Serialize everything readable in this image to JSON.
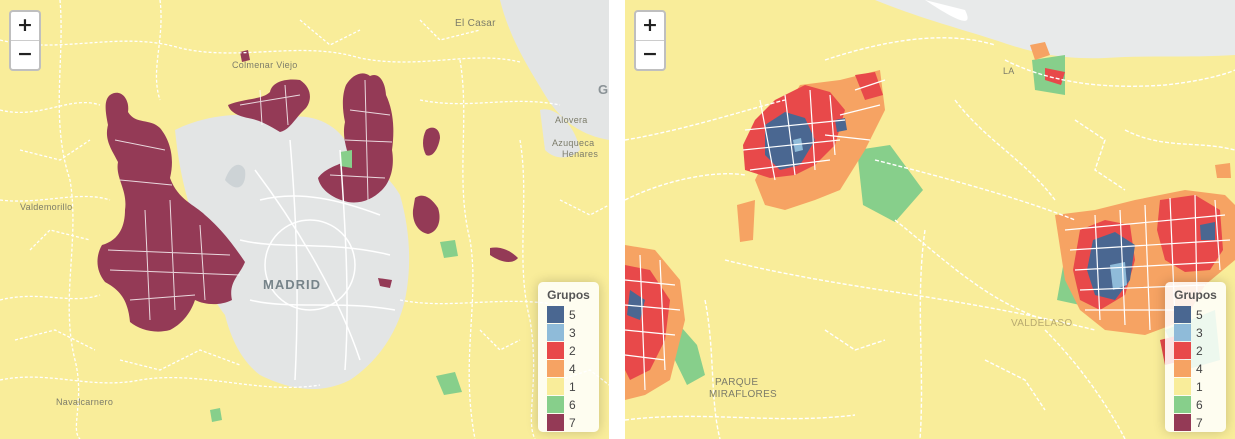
{
  "colors": {
    "g5": "#4a6791",
    "g3": "#8fbbd9",
    "g2": "#e8494a",
    "g4": "#f6a363",
    "g1": "#f9ed9a",
    "g6": "#87cf8b",
    "g7": "#943a56",
    "city_gray": "#e3e5e5",
    "street": "#ffffff"
  },
  "left_map": {
    "zoom_in": "+",
    "zoom_out": "−",
    "legend": {
      "title": "Grupos",
      "items": [
        {
          "label": "5",
          "color": "#4a6791"
        },
        {
          "label": "3",
          "color": "#8fbbd9"
        },
        {
          "label": "2",
          "color": "#e8494a"
        },
        {
          "label": "4",
          "color": "#f6a363"
        },
        {
          "label": "1",
          "color": "#f9ed9a"
        },
        {
          "label": "6",
          "color": "#87cf8b"
        },
        {
          "label": "7",
          "color": "#943a56"
        }
      ]
    },
    "labels": {
      "madrid": "MADRID",
      "el_casar": "El Casar",
      "alovera": "Alovera",
      "azuqueca_1": "Azuqueca",
      "azuqueca_2": "Henares",
      "colmenar": "Colmenar Viejo",
      "valdemorillo": "Valdemorillo",
      "navalcarnero": "Navalcarnero",
      "g_edge": "G"
    }
  },
  "right_map": {
    "zoom_in": "+",
    "zoom_out": "−",
    "legend": {
      "title": "Grupos",
      "items": [
        {
          "label": "5",
          "color": "#4a6791"
        },
        {
          "label": "3",
          "color": "#8fbbd9"
        },
        {
          "label": "2",
          "color": "#e8494a"
        },
        {
          "label": "4",
          "color": "#f6a363"
        },
        {
          "label": "1",
          "color": "#f9ed9a"
        },
        {
          "label": "6",
          "color": "#87cf8b"
        },
        {
          "label": "7",
          "color": "#943a56"
        }
      ]
    },
    "labels": {
      "parque_1": "PARQUE",
      "parque_2": "MIRAFLORES",
      "valdelaso": "VALDELASO",
      "la": "LA"
    }
  }
}
